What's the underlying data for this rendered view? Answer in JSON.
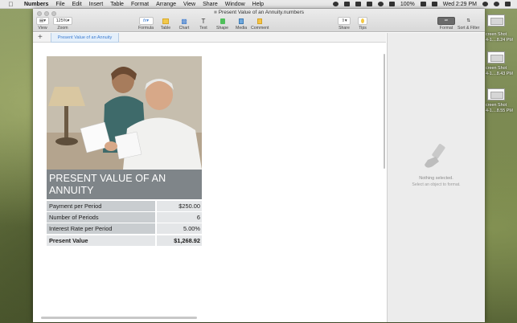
{
  "menubar": {
    "app_name": "Numbers",
    "items": [
      "File",
      "Edit",
      "Insert",
      "Table",
      "Format",
      "Arrange",
      "View",
      "Share",
      "Window",
      "Help"
    ],
    "battery": "100%",
    "clock": "Wed 2:29 PM"
  },
  "window": {
    "title": "Present Value of an Annuity.numbers",
    "toolbar": {
      "view_label": "View",
      "zoom_value": "125%",
      "zoom_label": "Zoom",
      "formula_label": "Formula",
      "table_label": "Table",
      "chart_label": "Chart",
      "text_label": "Text",
      "shape_label": "Shape",
      "media_label": "Media",
      "comment_label": "Comment",
      "share_label": "Share",
      "tips_label": "Tips",
      "format_label": "Format",
      "sort_filter_label": "Sort & Filter"
    },
    "sheet_tab": "Present Value of an Annuity"
  },
  "card": {
    "heading": "PRESENT VALUE OF AN ANNUITY",
    "rows": [
      {
        "label": "Payment per Period",
        "value": "$250.00"
      },
      {
        "label": "Number of Periods",
        "value": "6"
      },
      {
        "label": "Interest Rate per Period",
        "value": "5.00%"
      }
    ],
    "total": {
      "label": "Present Value",
      "value": "$1,268.92"
    }
  },
  "inspector": {
    "message": "Nothing selected.",
    "hint": "Select an object to format."
  },
  "desktop_files": [
    {
      "name_line1": "creen Shot",
      "name_line2": "4-1....8.24 PM"
    },
    {
      "name_line1": "creen Shot",
      "name_line2": "4-1....8.43 PM"
    },
    {
      "name_line1": "creen Shot",
      "name_line2": "4-1....8.55 PM"
    }
  ],
  "colors": {
    "header_band": "#7f8589",
    "label_cell": "#c9cdd0",
    "value_cell": "#e4e6e8",
    "tab_accent": "#3b7bd0"
  }
}
